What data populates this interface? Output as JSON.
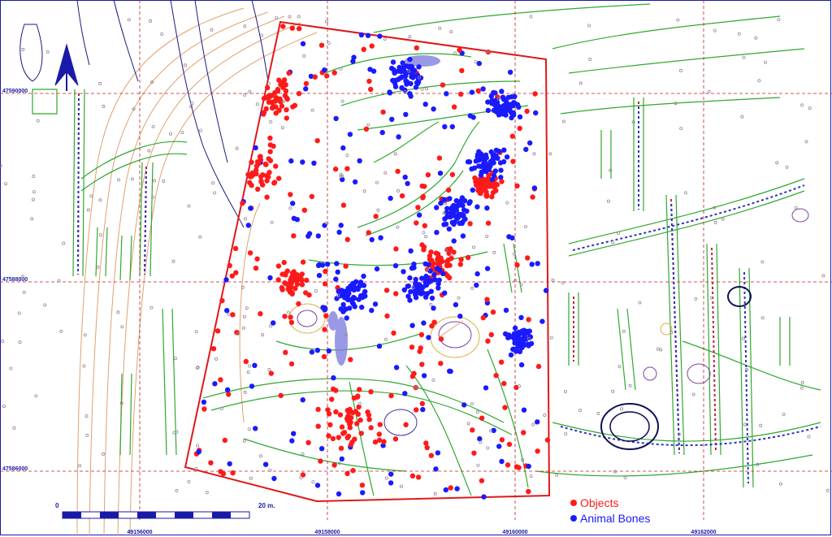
{
  "coordinates": {
    "northing": [
      "47590000",
      "47588000",
      "47586000"
    ],
    "easting": [
      "49156000",
      "49158000",
      "49160000",
      "49162000"
    ]
  },
  "legend": {
    "objects": {
      "label": "Objects",
      "color": "#ff1a1a"
    },
    "bones": {
      "label": "Animal Bones",
      "color": "#1a1aff"
    }
  },
  "scale": {
    "start_label": "0",
    "end_label": "20 m."
  },
  "colors": {
    "boundary": "#e01818",
    "features": "#2fa82f",
    "contours": "#e0a070",
    "grid": "#c02020",
    "ink": "#1a1aa8"
  },
  "icons": {
    "north_arrow": "north-arrow-icon"
  }
}
